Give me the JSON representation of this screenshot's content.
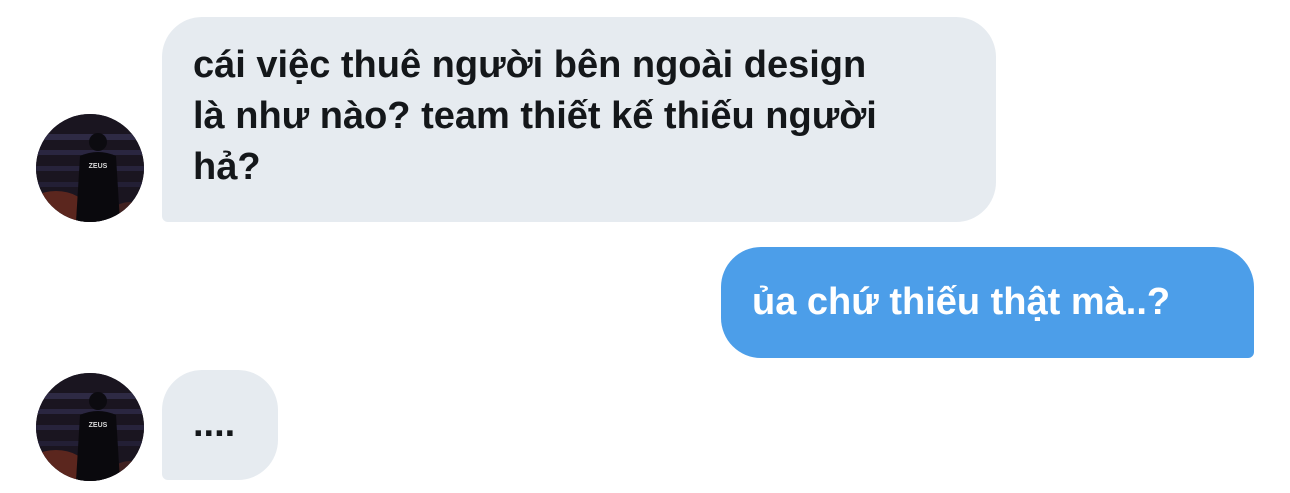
{
  "conversation": {
    "messages": [
      {
        "sender": "other",
        "text": "cái việc thuê người bên ngoài design là như nào? team thiết kế thiếu người hả?",
        "lines": [
          "cái việc thuê người bên ngoài design",
          "là như nào? team thiết kế thiếu người",
          "hả?"
        ]
      },
      {
        "sender": "me",
        "text": "ủa chứ thiếu thật mà..?"
      },
      {
        "sender": "other",
        "text": "...."
      }
    ],
    "avatar": {
      "jersey_text": "ZEUS",
      "icon": "user-avatar-photo"
    }
  },
  "colors": {
    "incoming_bubble": "#e6ebf0",
    "outgoing_bubble": "#4c9ee9",
    "incoming_text": "#14171a",
    "outgoing_text": "#ffffff"
  }
}
